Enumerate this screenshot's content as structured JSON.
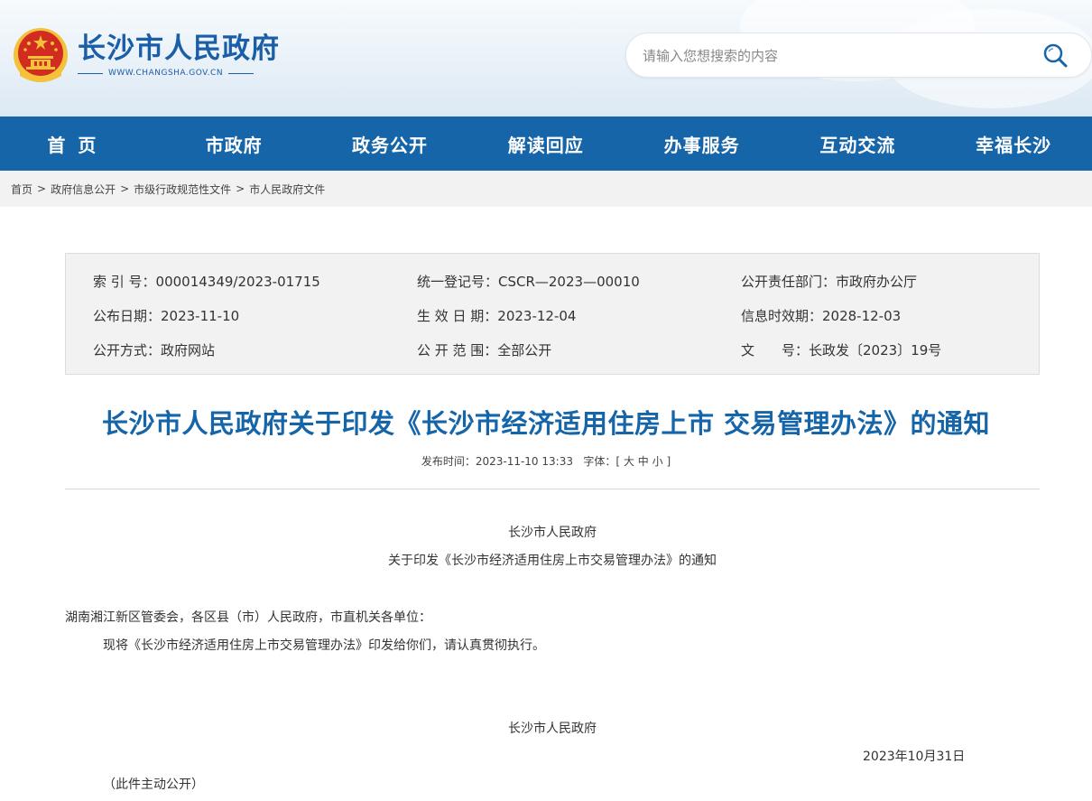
{
  "header": {
    "site_name": "长沙市人民政府",
    "site_domain": "WWW.CHANGSHA.GOV.CN",
    "search_placeholder": "请输入您想搜索的内容"
  },
  "nav": [
    "首页",
    "市政府",
    "政务公开",
    "解读回应",
    "办事服务",
    "互动交流",
    "幸福长沙"
  ],
  "breadcrumb": [
    "首页",
    "政府信息公开",
    "市级行政规范性文件",
    "市人民政府文件"
  ],
  "meta": {
    "index_no": "索 引 号：000014349/2023-01715",
    "reg_no": "统一登记号：CSCR—2023—00010",
    "dept": "公开责任部门：市政府办公厅",
    "pub_date": "公布日期：2023-11-10",
    "eff_date": "生 效 日 期：2023-12-04",
    "expire": "信息时效期：2028-12-03",
    "method": "公开方式：政府网站",
    "scope": "公 开 范 围：全部公开",
    "doc_no": "文　　号：长政发〔2023〕19号"
  },
  "article": {
    "title": "长沙市人民政府关于印发《长沙市经济适用住房上市 交易管理办法》的通知",
    "publish_time": "发布时间：2023-11-10 13:33",
    "font_label": "字体：[",
    "font_large": "大",
    "font_medium": "中",
    "font_small": "小",
    "font_close": "]",
    "issuer_header": "长沙市人民政府",
    "subtitle": "关于印发《长沙市经济适用住房上市交易管理办法》的通知",
    "recipients": "湖南湘江新区管委会，各区县（市）人民政府，市直机关各单位：",
    "body": "现将《长沙市经济适用住房上市交易管理办法》印发给你们，请认真贯彻执行。",
    "signature": "长沙市人民政府",
    "date": "2023年10月31日",
    "note": "（此件主动公开）"
  },
  "colors": {
    "brand": "#1565a8",
    "nav_bg": "#1565a8",
    "emblem_red": "#d22b1f",
    "emblem_gold": "#f3c13a"
  }
}
